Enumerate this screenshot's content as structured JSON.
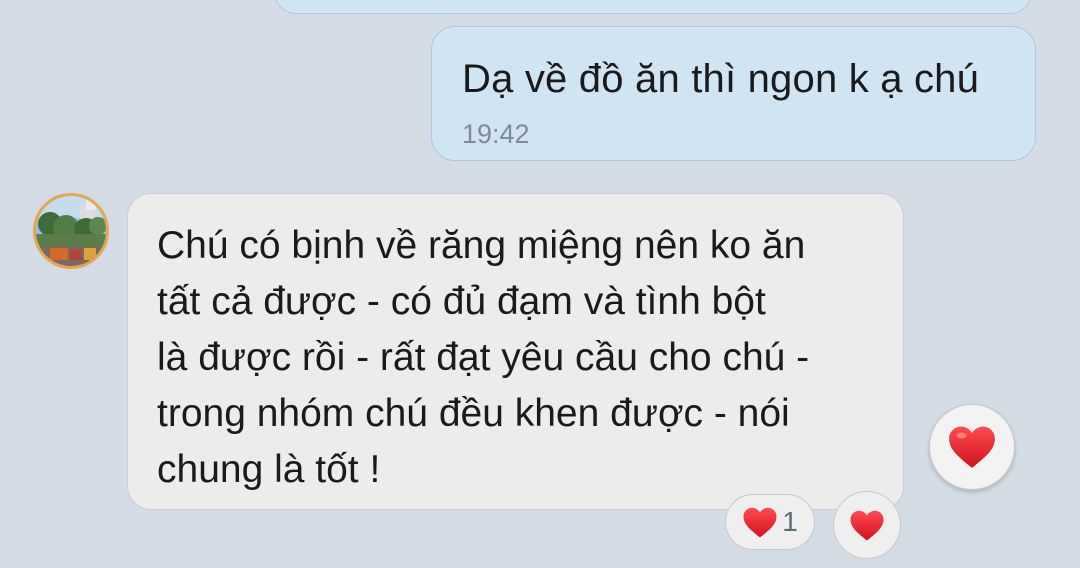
{
  "messages": {
    "outgoing": {
      "text": "Dạ về đồ ăn thì ngon k ạ chú",
      "time": "19:42"
    },
    "incoming": {
      "lines": [
        "Chú có bịnh về răng miệng nên ko ăn",
        "tất cả được - có đủ đạm và tình bột",
        "là được rồi - rất đạt yêu cầu cho chú -",
        "trong nhóm chú đều khen được - nói",
        "chung là tốt !"
      ],
      "avatar_icon": "contact-avatar"
    }
  },
  "reactions": {
    "fab_icon": "heart-icon",
    "pill_icon": "heart-icon",
    "pill_count": "1",
    "circle_icon": "heart-icon",
    "heart_color": "#e5232f"
  },
  "theme": {
    "background": "#d3dbe4",
    "outgoing_bubble": "#cfe5f4",
    "incoming_bubble": "#ececec"
  }
}
